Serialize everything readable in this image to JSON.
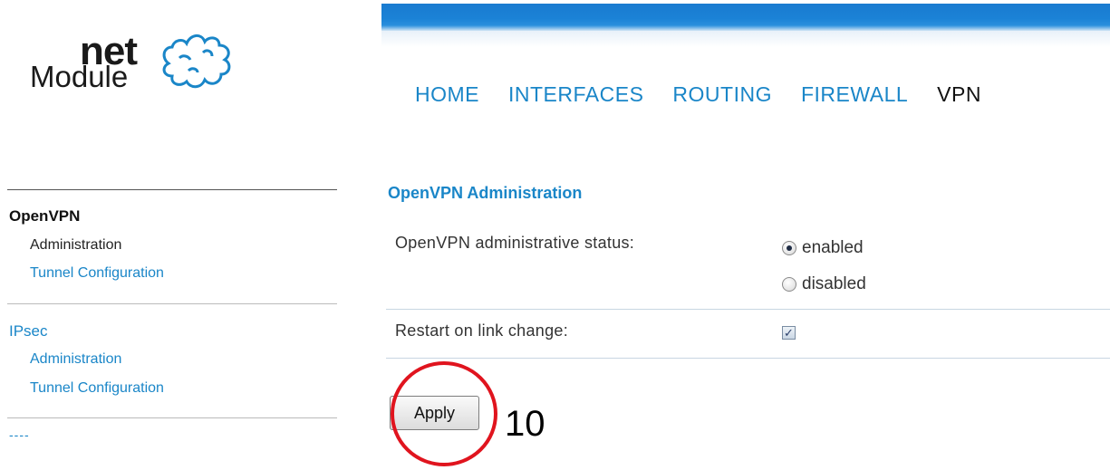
{
  "logo": {
    "word1": "net",
    "word2": "Module"
  },
  "nav": [
    "HOME",
    "INTERFACES",
    "ROUTING",
    "FIREWALL",
    "VPN"
  ],
  "nav_active": "VPN",
  "sidebar": {
    "groups": [
      {
        "title": "OpenVPN",
        "items": [
          "Administration",
          "Tunnel Configuration"
        ]
      },
      {
        "title": "IPsec",
        "items": [
          "Administration",
          "Tunnel Configuration"
        ]
      }
    ],
    "more": "----"
  },
  "content": {
    "title": "OpenVPN Administration",
    "status_label": "OpenVPN administrative status:",
    "options": [
      "enabled",
      "disabled"
    ],
    "selected": "enabled",
    "restart_label": "Restart on link change:",
    "restart_checked": true,
    "apply": "Apply"
  },
  "annotation": {
    "number": "10",
    "color": "#e0141e"
  },
  "colors": {
    "link": "#1a86c8",
    "banner": "#1b82d6"
  }
}
